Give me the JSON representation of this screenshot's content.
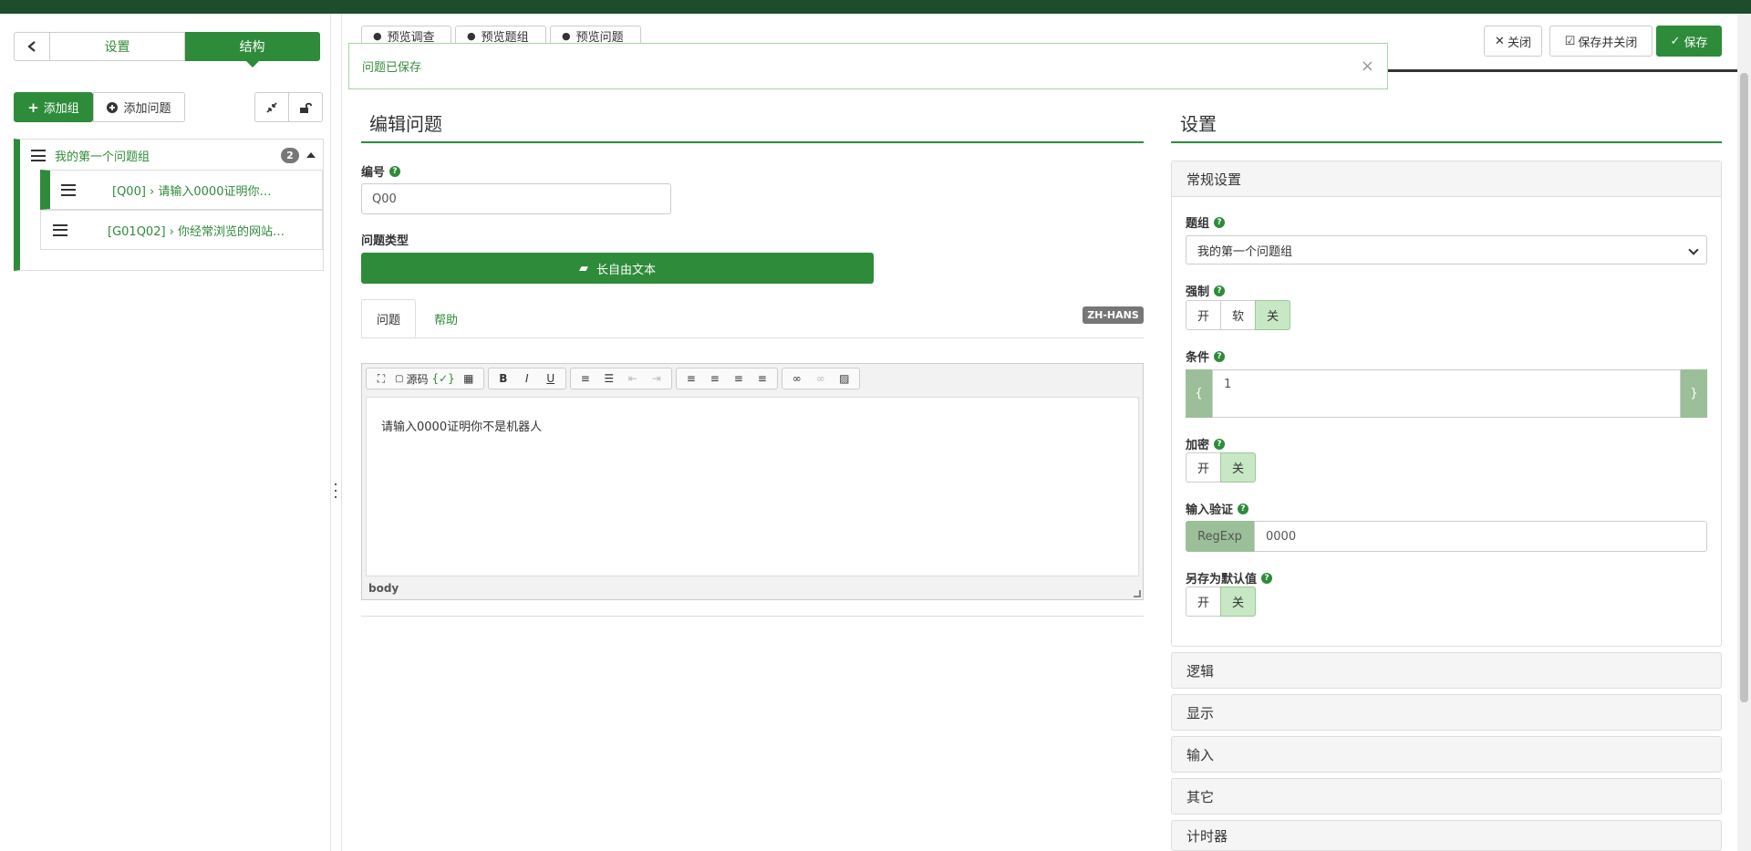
{
  "sidebar": {
    "tabs": [
      "设置",
      "结构"
    ],
    "add_group": "添加组",
    "add_question": "添加问题",
    "group": {
      "label": "我的第一个问题组",
      "count": "2"
    },
    "items": [
      {
        "label": "[Q00] › 请输入0000证明你…"
      },
      {
        "label": "[G01Q02] › 你经常浏览的网站…"
      }
    ]
  },
  "preview_tabs": [
    "预览调查",
    "预览题组",
    "预览问题"
  ],
  "top_buttons": {
    "close": "关闭",
    "save_close": "保存并关闭",
    "save": "保存"
  },
  "alert": {
    "text": "问题已保存",
    "close": "×"
  },
  "editor": {
    "title": "编辑问题",
    "code_label": "编号",
    "code_value": "Q00",
    "type_label": "问题类型",
    "type_value": "长自由文本",
    "tabs": [
      "问题",
      "帮助"
    ],
    "language": "ZH-HANS",
    "toolbar": [
      "源码"
    ],
    "content": "请输入0000证明你不是机器人",
    "path": "body"
  },
  "settings": {
    "title": "设置",
    "general": "常规设置",
    "group_label": "题组",
    "group_value": "我的第一个问题组",
    "mandatory_label": "强制",
    "mandatory_options": [
      "开",
      "软",
      "关"
    ],
    "mandatory_selected": "关",
    "condition_label": "条件",
    "condition_value": "1",
    "condition_open": "{",
    "condition_close": "}",
    "encrypt_label": "加密",
    "encrypt_options": [
      "开",
      "关"
    ],
    "validation_label": "输入验证",
    "validation_addon": "RegExp",
    "validation_value": "0000",
    "default_label": "另存为默认值",
    "default_options": [
      "开",
      "关"
    ],
    "sections": [
      "逻辑",
      "显示",
      "输入",
      "其它",
      "计时器"
    ]
  },
  "colors": {
    "accent": "#2e8b3a",
    "topbar": "#1e4d2b",
    "toggle_on": "#c7e7c5"
  }
}
